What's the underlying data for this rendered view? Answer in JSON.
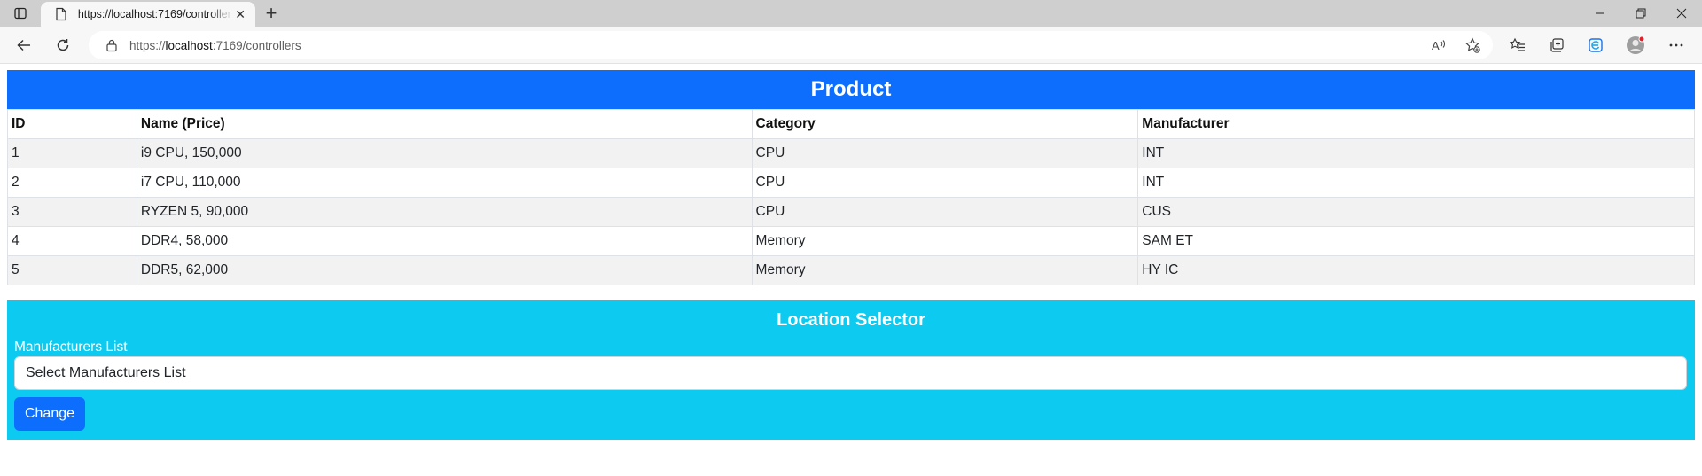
{
  "browser": {
    "tab_title": "https://localhost:7169/controllers",
    "url_prefix": "https://",
    "url_host": "localhost",
    "url_rest": ":7169/controllers"
  },
  "product": {
    "heading": "Product",
    "columns": [
      "ID",
      "Name (Price)",
      "Category",
      "Manufacturer"
    ],
    "rows": [
      [
        "1",
        "i9 CPU, 150,000",
        "CPU",
        "INT"
      ],
      [
        "2",
        "i7 CPU, 110,000",
        "CPU",
        "INT"
      ],
      [
        "3",
        "RYZEN 5, 90,000",
        "CPU",
        "CUS"
      ],
      [
        "4",
        "DDR4, 58,000",
        "Memory",
        "SAM ET"
      ],
      [
        "5",
        "DDR5, 62,000",
        "Memory",
        "HY IC"
      ]
    ]
  },
  "location": {
    "heading": "Location Selector",
    "label": "Manufacturers List",
    "selected": "Select Manufacturers List",
    "button": "Change"
  },
  "colors": {
    "primary": "#0d6efd",
    "info": "#0dcaf0"
  }
}
